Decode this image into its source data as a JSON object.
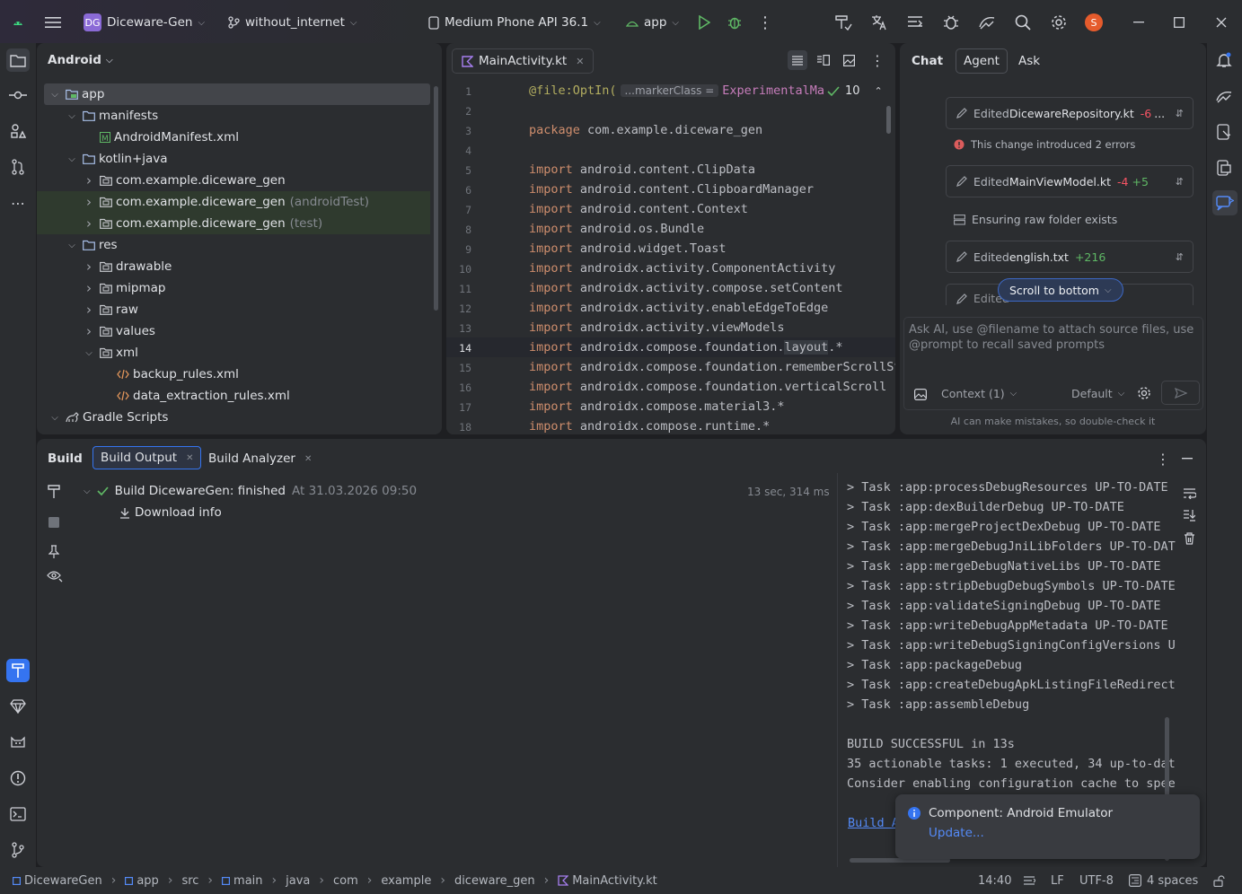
{
  "titlebar": {
    "project_badge": "DG",
    "project": "Diceware-Gen",
    "branch": "without_internet",
    "device": "Medium Phone API 36.1",
    "run_config": "app",
    "avatar": "S"
  },
  "project_panel": {
    "view": "Android",
    "tree": [
      {
        "label": "app",
        "depth": 0,
        "expanded": true,
        "selected": true
      },
      {
        "label": "manifests",
        "depth": 1,
        "expanded": true
      },
      {
        "label": "AndroidManifest.xml",
        "depth": 2,
        "file": "manifest"
      },
      {
        "label": "kotlin+java",
        "depth": 1,
        "expanded": true
      },
      {
        "label": "com.example.diceware_gen",
        "depth": 2,
        "collapsed": true
      },
      {
        "label": "com.example.diceware_gen",
        "suffix": "(androidTest)",
        "depth": 2,
        "collapsed": true,
        "tinted": true
      },
      {
        "label": "com.example.diceware_gen",
        "suffix": "(test)",
        "depth": 2,
        "collapsed": true,
        "tinted": true
      },
      {
        "label": "res",
        "depth": 1,
        "expanded": true
      },
      {
        "label": "drawable",
        "depth": 2,
        "collapsed": true
      },
      {
        "label": "mipmap",
        "depth": 2,
        "collapsed": true
      },
      {
        "label": "raw",
        "depth": 2,
        "collapsed": true
      },
      {
        "label": "values",
        "depth": 2,
        "collapsed": true
      },
      {
        "label": "xml",
        "depth": 2,
        "expanded": true
      },
      {
        "label": "backup_rules.xml",
        "depth": 3,
        "file": "xml"
      },
      {
        "label": "data_extraction_rules.xml",
        "depth": 3,
        "file": "xml"
      },
      {
        "label": "Gradle Scripts",
        "depth": 0,
        "expanded": true
      }
    ]
  },
  "editor": {
    "tab": "MainActivity.kt",
    "inlay_hint": "...markerClass =",
    "problems_count": "10",
    "current_line": "14",
    "lines": [
      {
        "n": "1",
        "kw": "",
        "text": ""
      },
      {
        "n": "2",
        "kw": "",
        "text": ""
      },
      {
        "n": "3",
        "kw": "package",
        "text": " com.example.diceware_gen"
      },
      {
        "n": "4",
        "kw": "",
        "text": ""
      },
      {
        "n": "5",
        "kw": "import",
        "text": " android.content.ClipData"
      },
      {
        "n": "6",
        "kw": "import",
        "text": " android.content.ClipboardManager"
      },
      {
        "n": "7",
        "kw": "import",
        "text": " android.content.Context"
      },
      {
        "n": "8",
        "kw": "import",
        "text": " android.os.Bundle"
      },
      {
        "n": "9",
        "kw": "import",
        "text": " android.widget.Toast"
      },
      {
        "n": "10",
        "kw": "import",
        "text": " androidx.activity.ComponentActivity"
      },
      {
        "n": "11",
        "kw": "import",
        "text": " androidx.activity.compose.setContent"
      },
      {
        "n": "12",
        "kw": "import",
        "text": " androidx.activity.enableEdgeToEdge"
      },
      {
        "n": "13",
        "kw": "import",
        "text": " androidx.activity.viewModels"
      },
      {
        "n": "14",
        "kw": "import",
        "text": " androidx.compose.foundation.layout.*"
      },
      {
        "n": "15",
        "kw": "import",
        "text": " androidx.compose.foundation.rememberScrollSt"
      },
      {
        "n": "16",
        "kw": "import",
        "text": " androidx.compose.foundation.verticalScroll"
      },
      {
        "n": "17",
        "kw": "import",
        "text": " androidx.compose.material3.*"
      },
      {
        "n": "18",
        "kw": "import",
        "text": " androidx.compose.runtime.*"
      }
    ],
    "line1_prefix": "@file:OptIn(",
    "line1_suffix": "ExperimentalMa"
  },
  "ai_panel": {
    "tabs": [
      "Chat",
      "Agent",
      "Ask"
    ],
    "active_tab": "Agent",
    "cards": [
      {
        "prefix": "Edited ",
        "file": "DicewareRepository.kt",
        "removed": "-6",
        "added": "",
        "more": "..."
      },
      {
        "prefix": "Edited ",
        "file": "MainViewModel.kt",
        "removed": "-4",
        "added": "+5",
        "more": ""
      },
      {
        "prefix": "Edited ",
        "file": "english.txt",
        "removed": "",
        "added": "+216",
        "more": ""
      }
    ],
    "error_note": "This change introduced 2 errors",
    "ensuring_note": "Ensuring raw folder exists",
    "partial_card": "Edited",
    "scroll_button": "Scroll to bottom",
    "input_placeholder": "Ask AI, use @filename to attach source files, use @prompt to recall saved prompts",
    "context_label": "Context (1)",
    "mode_label": "Default",
    "disclaimer": "AI can make mistakes, so double-check it"
  },
  "build_panel": {
    "tabs": [
      {
        "label": "Build",
        "closable": false
      },
      {
        "label": "Build Output",
        "closable": true,
        "active": true
      },
      {
        "label": "Build Analyzer",
        "closable": true
      }
    ],
    "result": {
      "title": "Build DicewareGen:",
      "status": " finished",
      "time": "At 31.03.2026 09:50",
      "duration": "13 sec, 314 ms",
      "download": "Download info"
    },
    "output": [
      "> Task :app:processDebugResources UP-TO-DATE",
      "> Task :app:dexBuilderDebug UP-TO-DATE",
      "> Task :app:mergeProjectDexDebug UP-TO-DATE",
      "> Task :app:mergeDebugJniLibFolders UP-TO-DAT",
      "> Task :app:mergeDebugNativeLibs UP-TO-DATE",
      "> Task :app:stripDebugDebugSymbols UP-TO-DATE",
      "> Task :app:validateSigningDebug UP-TO-DATE",
      "> Task :app:writeDebugAppMetadata UP-TO-DATE",
      "> Task :app:writeDebugSigningConfigVersions U",
      "> Task :app:packageDebug",
      "> Task :app:createDebugApkListingFileRedirect",
      "> Task :app:assembleDebug",
      "",
      "BUILD SUCCESSFUL in 13s",
      "35 actionable tasks: 1 executed, 34 up-to-dat",
      "Consider enabling configuration cache to spee"
    ],
    "link_fragment": "Build A"
  },
  "notification": {
    "title": "Component: Android Emulator",
    "action": "Update..."
  },
  "statusbar": {
    "breadcrumbs": [
      "DicewareGen",
      "app",
      "src",
      "main",
      "java",
      "com",
      "example",
      "diceware_gen",
      "MainActivity.kt"
    ],
    "position": "14:40",
    "line_sep": "LF",
    "encoding": "UTF-8",
    "indent": "4 spaces"
  },
  "colors": {
    "accent": "#3574f0",
    "success": "#5fb865",
    "error": "#f75464",
    "keyword": "#cf8e6d",
    "avatar": "#e55b2c"
  }
}
